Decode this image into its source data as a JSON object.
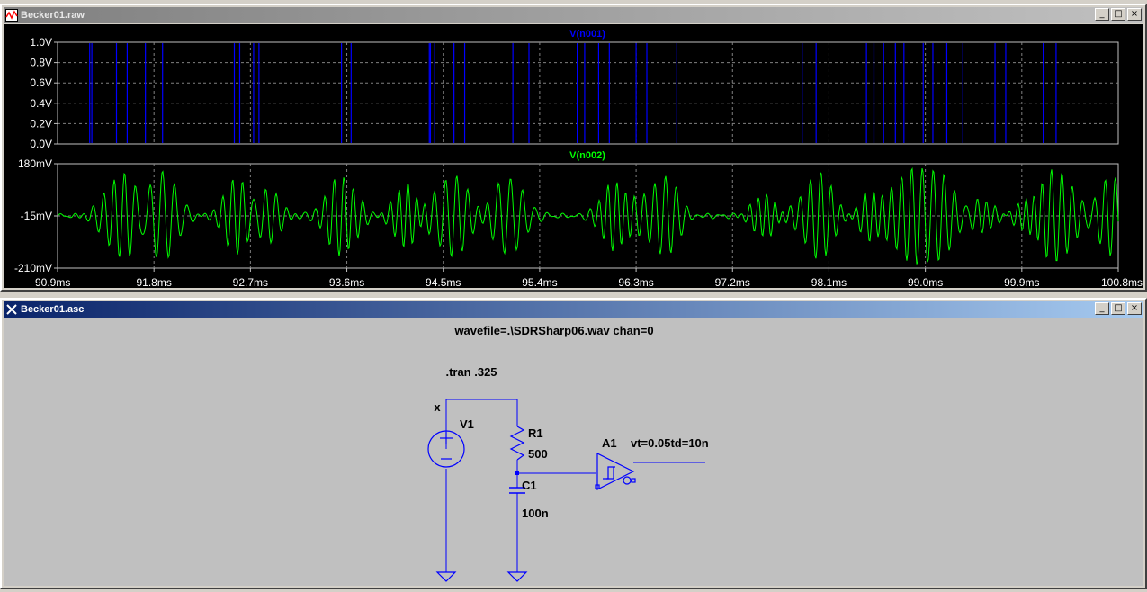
{
  "windows": {
    "raw": {
      "title": "Becker01.raw",
      "btn_min": "_",
      "btn_max": "□",
      "btn_close": "×"
    },
    "asc": {
      "title": "Becker01.asc",
      "btn_min": "_",
      "btn_max": "□",
      "btn_close": "×"
    }
  },
  "chart_data": [
    {
      "type": "line",
      "title": "V(n001)",
      "color": "#0000ff",
      "yticks": [
        "1.0V",
        "0.8V",
        "0.6V",
        "0.4V",
        "0.2V",
        "0.0V"
      ],
      "ylim": [
        0,
        1.0
      ],
      "xlim": [
        90.9,
        100.8
      ],
      "grid": true,
      "pulses_ms": [
        91.2,
        91.22,
        91.45,
        91.55,
        91.72,
        91.88,
        92.55,
        92.6,
        92.73,
        92.78,
        93.55,
        93.64,
        94.37,
        94.38,
        94.42,
        94.6,
        94.7,
        95.15,
        95.3,
        95.75,
        95.82,
        95.95,
        96.05,
        96.3,
        96.4,
        96.68,
        97.85,
        97.98,
        98.45,
        98.52,
        98.61,
        98.72,
        98.8,
        98.98,
        99.07,
        99.2,
        99.35,
        99.65,
        99.75,
        100.1,
        100.22
      ]
    },
    {
      "type": "line",
      "title": "V(n002)",
      "color": "#00ff00",
      "yticks": [
        "180mV",
        "-15mV",
        "-210mV"
      ],
      "ylim": [
        -210,
        180
      ],
      "xticks": [
        "90.9ms",
        "91.8ms",
        "92.7ms",
        "93.6ms",
        "94.5ms",
        "95.4ms",
        "96.3ms",
        "97.2ms",
        "98.1ms",
        "99.0ms",
        "99.9ms",
        "100.8ms"
      ],
      "xlim": [
        90.9,
        100.8
      ],
      "grid": true,
      "bursts": [
        {
          "t": 91.5,
          "amp": 150,
          "freq": 2.6,
          "width": 0.22
        },
        {
          "t": 91.85,
          "amp": 170,
          "freq": 2.2,
          "width": 0.22
        },
        {
          "t": 92.6,
          "amp": 150,
          "freq": 2.8,
          "width": 0.18
        },
        {
          "t": 92.82,
          "amp": 130,
          "freq": 2.6,
          "width": 0.18
        },
        {
          "t": 93.55,
          "amp": 145,
          "freq": 2.8,
          "width": 0.2
        },
        {
          "t": 94.15,
          "amp": 120,
          "freq": 3.0,
          "width": 0.15
        },
        {
          "t": 94.6,
          "amp": 155,
          "freq": 2.4,
          "width": 0.22
        },
        {
          "t": 95.1,
          "amp": 150,
          "freq": 2.2,
          "width": 0.2
        },
        {
          "t": 96.1,
          "amp": 130,
          "freq": 3.0,
          "width": 0.18
        },
        {
          "t": 96.55,
          "amp": 150,
          "freq": 2.5,
          "width": 0.2
        },
        {
          "t": 97.5,
          "amp": 80,
          "freq": 3.2,
          "width": 0.15
        },
        {
          "t": 98.0,
          "amp": 160,
          "freq": 2.6,
          "width": 0.2
        },
        {
          "t": 98.5,
          "amp": 100,
          "freq": 3.0,
          "width": 0.16
        },
        {
          "t": 98.85,
          "amp": 160,
          "freq": 2.6,
          "width": 0.2
        },
        {
          "t": 99.15,
          "amp": 150,
          "freq": 2.5,
          "width": 0.2
        },
        {
          "t": 99.55,
          "amp": 60,
          "freq": 3.0,
          "width": 0.15
        },
        {
          "t": 100.0,
          "amp": 90,
          "freq": 3.2,
          "width": 0.16
        },
        {
          "t": 100.25,
          "amp": 165,
          "freq": 2.6,
          "width": 0.2
        },
        {
          "t": 100.75,
          "amp": 150,
          "freq": 2.6,
          "width": 0.18
        }
      ]
    }
  ],
  "schematic": {
    "wavefile_directive": "wavefile=.\\SDRSharp06.wav chan=0",
    "tran_directive": ".tran .325",
    "v1_name": "V1",
    "v1_marker": "x",
    "r1_name": "R1",
    "r1_value": "500",
    "c1_name": "C1",
    "c1_value": "100n",
    "a1_name": "A1",
    "a1_params": "vt=0.05td=10n",
    "wire_color": "#0000ff",
    "body_color": "#0000ff"
  }
}
